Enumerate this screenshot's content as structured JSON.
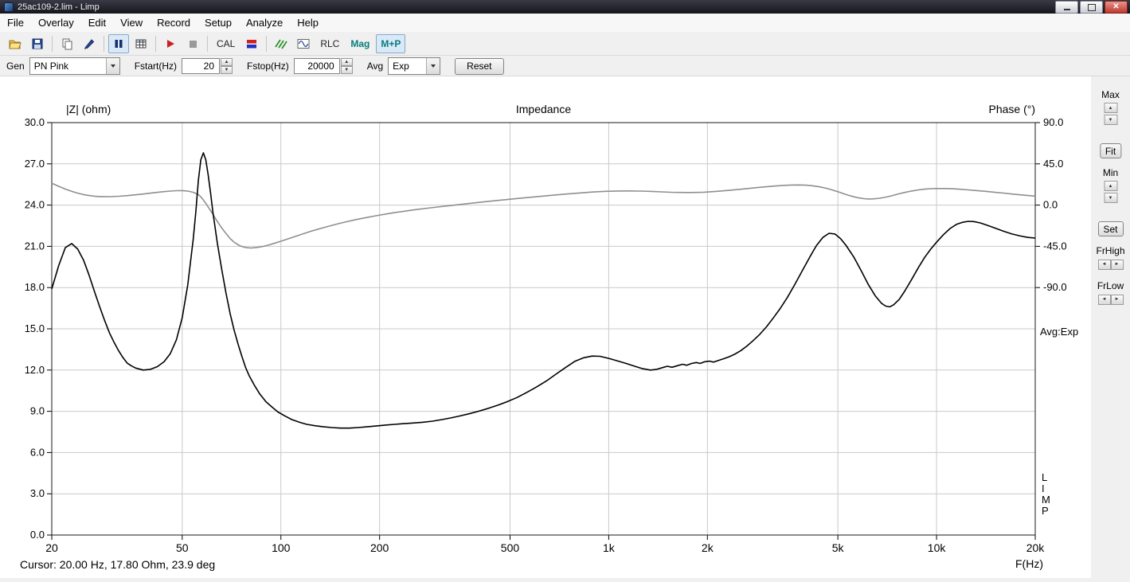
{
  "window": {
    "title": "25ac109-2.lim - Limp"
  },
  "menu": {
    "items": [
      "File",
      "Overlay",
      "Edit",
      "View",
      "Record",
      "Setup",
      "Analyze",
      "Help"
    ]
  },
  "toolbar": {
    "cal": "CAL",
    "rlc": "RLC",
    "mag": "Mag",
    "mp": "M+P"
  },
  "controls": {
    "gen_label": "Gen",
    "gen_value": "PN Pink",
    "fstart_label": "Fstart(Hz)",
    "fstart_value": "20",
    "fstop_label": "Fstop(Hz)",
    "fstop_value": "20000",
    "avg_label": "Avg",
    "avg_value": "Exp",
    "reset": "Reset"
  },
  "side_panel": {
    "max": "Max",
    "fit": "Fit",
    "min": "Min",
    "set": "Set",
    "frhigh": "FrHigh",
    "frlow": "FrLow"
  },
  "icons": {
    "up": "▲",
    "down": "▼",
    "left": "◄",
    "right": "►"
  },
  "status": {
    "cursor": "Cursor: 20.00 Hz, 17.80 Ohm, 23.9 deg"
  },
  "chart_data": {
    "type": "line",
    "title": "Impedance",
    "left_axis_label": "|Z| (ohm)",
    "right_axis_label": "Phase (°)",
    "xlabel": "F(Hz)",
    "x_scale": "log",
    "x_range": [
      20,
      20000
    ],
    "left_range": [
      0,
      30
    ],
    "grid": true,
    "x_ticks": [
      {
        "value": 20,
        "label": "20"
      },
      {
        "value": 50,
        "label": "50"
      },
      {
        "value": 100,
        "label": "100"
      },
      {
        "value": 200,
        "label": "200"
      },
      {
        "value": 500,
        "label": "500"
      },
      {
        "value": 1000,
        "label": "1k"
      },
      {
        "value": 2000,
        "label": "2k"
      },
      {
        "value": 5000,
        "label": "5k"
      },
      {
        "value": 10000,
        "label": "10k"
      },
      {
        "value": 20000,
        "label": "20k"
      }
    ],
    "left_ticks": [
      {
        "value": 0,
        "label": "0.0"
      },
      {
        "value": 3,
        "label": "3.0"
      },
      {
        "value": 6,
        "label": "6.0"
      },
      {
        "value": 9,
        "label": "9.0"
      },
      {
        "value": 12,
        "label": "12.0"
      },
      {
        "value": 15,
        "label": "15.0"
      },
      {
        "value": 18,
        "label": "18.0"
      },
      {
        "value": 21,
        "label": "21.0"
      },
      {
        "value": 24,
        "label": "24.0"
      },
      {
        "value": 27,
        "label": "27.0"
      },
      {
        "value": 30,
        "label": "30.0"
      }
    ],
    "right_ticks": [
      {
        "phase": 90,
        "label": "90.0"
      },
      {
        "phase": 45,
        "label": "45.0"
      },
      {
        "phase": 0,
        "label": "0.0"
      },
      {
        "phase": -45,
        "label": "-45.0"
      },
      {
        "phase": -90,
        "label": "-90.0"
      }
    ],
    "phase_axis": {
      "zero_z": 24,
      "deg_per_ohm": 15
    },
    "avg_annotation": "Avg:Exp",
    "watermark": "LIMP",
    "colors": {
      "impedance": "#000000",
      "phase": "#8f8f8f",
      "grid": "#c9c9c9",
      "border": "#1a1a1a"
    },
    "series": [
      {
        "name": "impedance_ohm",
        "axis": "left",
        "color_key": "impedance",
        "points": [
          [
            20,
            17.9
          ],
          [
            21,
            19.6
          ],
          [
            22,
            20.9
          ],
          [
            23,
            21.2
          ],
          [
            24,
            20.8
          ],
          [
            25,
            20
          ],
          [
            26,
            18.9
          ],
          [
            27,
            17.7
          ],
          [
            28,
            16.6
          ],
          [
            29,
            15.6
          ],
          [
            30,
            14.7
          ],
          [
            31,
            14
          ],
          [
            32,
            13.4
          ],
          [
            33,
            12.9
          ],
          [
            34,
            12.5
          ],
          [
            35,
            12.3
          ],
          [
            36,
            12.15
          ],
          [
            38,
            12
          ],
          [
            40,
            12.05
          ],
          [
            42,
            12.25
          ],
          [
            44,
            12.6
          ],
          [
            46,
            13.2
          ],
          [
            48,
            14.2
          ],
          [
            50,
            15.8
          ],
          [
            52,
            18.2
          ],
          [
            54,
            21.5
          ],
          [
            55,
            23.5
          ],
          [
            56,
            25.8
          ],
          [
            57,
            27.3
          ],
          [
            58,
            27.8
          ],
          [
            59,
            27.3
          ],
          [
            60,
            26.2
          ],
          [
            61,
            24.9
          ],
          [
            62,
            23.5
          ],
          [
            64,
            21.2
          ],
          [
            66,
            19.3
          ],
          [
            68,
            17.6
          ],
          [
            70,
            16.1
          ],
          [
            72,
            14.9
          ],
          [
            74,
            13.9
          ],
          [
            76,
            13
          ],
          [
            78,
            12.2
          ],
          [
            80,
            11.6
          ],
          [
            83,
            10.9
          ],
          [
            86,
            10.3
          ],
          [
            90,
            9.7
          ],
          [
            94,
            9.3
          ],
          [
            98,
            8.95
          ],
          [
            103,
            8.65
          ],
          [
            108,
            8.4
          ],
          [
            114,
            8.2
          ],
          [
            120,
            8.05
          ],
          [
            127,
            7.95
          ],
          [
            135,
            7.87
          ],
          [
            143,
            7.82
          ],
          [
            152,
            7.78
          ],
          [
            162,
            7.78
          ],
          [
            172,
            7.82
          ],
          [
            183,
            7.87
          ],
          [
            195,
            7.93
          ],
          [
            208,
            8
          ],
          [
            222,
            8.05
          ],
          [
            237,
            8.1
          ],
          [
            253,
            8.15
          ],
          [
            270,
            8.2
          ],
          [
            290,
            8.28
          ],
          [
            310,
            8.4
          ],
          [
            330,
            8.52
          ],
          [
            350,
            8.65
          ],
          [
            375,
            8.82
          ],
          [
            400,
            9
          ],
          [
            430,
            9.22
          ],
          [
            460,
            9.45
          ],
          [
            490,
            9.7
          ],
          [
            525,
            10
          ],
          [
            560,
            10.35
          ],
          [
            600,
            10.75
          ],
          [
            645,
            11.2
          ],
          [
            690,
            11.7
          ],
          [
            740,
            12.2
          ],
          [
            790,
            12.65
          ],
          [
            840,
            12.9
          ],
          [
            890,
            13.02
          ],
          [
            940,
            13
          ],
          [
            1000,
            12.85
          ],
          [
            1060,
            12.68
          ],
          [
            1130,
            12.48
          ],
          [
            1200,
            12.28
          ],
          [
            1270,
            12.1
          ],
          [
            1340,
            12
          ],
          [
            1400,
            12.05
          ],
          [
            1460,
            12.18
          ],
          [
            1510,
            12.28
          ],
          [
            1560,
            12.2
          ],
          [
            1620,
            12.32
          ],
          [
            1680,
            12.42
          ],
          [
            1730,
            12.35
          ],
          [
            1790,
            12.48
          ],
          [
            1850,
            12.55
          ],
          [
            1900,
            12.48
          ],
          [
            1960,
            12.6
          ],
          [
            2030,
            12.65
          ],
          [
            2090,
            12.58
          ],
          [
            2160,
            12.7
          ],
          [
            2240,
            12.82
          ],
          [
            2330,
            12.97
          ],
          [
            2430,
            13.17
          ],
          [
            2530,
            13.42
          ],
          [
            2640,
            13.75
          ],
          [
            2760,
            14.15
          ],
          [
            2890,
            14.6
          ],
          [
            3030,
            15.15
          ],
          [
            3180,
            15.8
          ],
          [
            3340,
            16.5
          ],
          [
            3510,
            17.3
          ],
          [
            3700,
            18.25
          ],
          [
            3900,
            19.25
          ],
          [
            4100,
            20.2
          ],
          [
            4300,
            21.05
          ],
          [
            4500,
            21.65
          ],
          [
            4700,
            21.95
          ],
          [
            4900,
            21.9
          ],
          [
            5100,
            21.55
          ],
          [
            5300,
            21.05
          ],
          [
            5600,
            20.2
          ],
          [
            5900,
            19.2
          ],
          [
            6200,
            18.2
          ],
          [
            6500,
            17.4
          ],
          [
            6800,
            16.85
          ],
          [
            7000,
            16.65
          ],
          [
            7200,
            16.6
          ],
          [
            7400,
            16.75
          ],
          [
            7700,
            17.15
          ],
          [
            8000,
            17.75
          ],
          [
            8400,
            18.6
          ],
          [
            8800,
            19.45
          ],
          [
            9200,
            20.2
          ],
          [
            9600,
            20.8
          ],
          [
            10000,
            21.3
          ],
          [
            10500,
            21.85
          ],
          [
            11000,
            22.3
          ],
          [
            11500,
            22.6
          ],
          [
            12000,
            22.75
          ],
          [
            12500,
            22.82
          ],
          [
            13000,
            22.8
          ],
          [
            13600,
            22.7
          ],
          [
            14200,
            22.55
          ],
          [
            15000,
            22.35
          ],
          [
            16000,
            22.1
          ],
          [
            17000,
            21.9
          ],
          [
            18000,
            21.75
          ],
          [
            19000,
            21.65
          ],
          [
            20000,
            21.6
          ]
        ]
      },
      {
        "name": "phase_deg",
        "axis": "phase",
        "color_key": "phase",
        "points": [
          [
            20,
            23.9
          ],
          [
            21,
            20.5
          ],
          [
            22,
            17.5
          ],
          [
            23,
            15
          ],
          [
            24,
            13
          ],
          [
            25,
            11.5
          ],
          [
            26,
            10.4
          ],
          [
            27,
            9.7
          ],
          [
            28,
            9.3
          ],
          [
            30,
            9.2
          ],
          [
            32,
            9.6
          ],
          [
            34,
            10.3
          ],
          [
            36,
            11.2
          ],
          [
            38,
            12.1
          ],
          [
            40,
            13
          ],
          [
            42,
            13.9
          ],
          [
            44,
            14.7
          ],
          [
            46,
            15.3
          ],
          [
            48,
            15.7
          ],
          [
            50,
            15.8
          ],
          [
            52,
            15.3
          ],
          [
            54,
            14
          ],
          [
            56,
            11.5
          ],
          [
            57,
            9
          ],
          [
            58,
            5.5
          ],
          [
            59,
            2
          ],
          [
            60,
            -2
          ],
          [
            62,
            -10
          ],
          [
            64,
            -18
          ],
          [
            66,
            -25
          ],
          [
            68,
            -31
          ],
          [
            70,
            -36.5
          ],
          [
            72,
            -40.5
          ],
          [
            75,
            -44.5
          ],
          [
            78,
            -46.3
          ],
          [
            81,
            -46.8
          ],
          [
            84,
            -46.3
          ],
          [
            88,
            -45.2
          ],
          [
            92,
            -43.4
          ],
          [
            96,
            -41.4
          ],
          [
            100,
            -39.4
          ],
          [
            106,
            -36.4
          ],
          [
            112,
            -33.5
          ],
          [
            118,
            -30.8
          ],
          [
            125,
            -28
          ],
          [
            132,
            -25.5
          ],
          [
            140,
            -23
          ],
          [
            150,
            -20.2
          ],
          [
            160,
            -17.8
          ],
          [
            170,
            -15.7
          ],
          [
            182,
            -13.6
          ],
          [
            195,
            -11.6
          ],
          [
            210,
            -9.6
          ],
          [
            225,
            -7.9
          ],
          [
            240,
            -6.5
          ],
          [
            260,
            -4.8
          ],
          [
            280,
            -3.4
          ],
          [
            300,
            -2.1
          ],
          [
            325,
            -0.7
          ],
          [
            350,
            0.6
          ],
          [
            380,
            2
          ],
          [
            410,
            3.3
          ],
          [
            450,
            4.8
          ],
          [
            490,
            6.1
          ],
          [
            530,
            7.3
          ],
          [
            580,
            8.6
          ],
          [
            630,
            9.8
          ],
          [
            690,
            11.1
          ],
          [
            750,
            12.2
          ],
          [
            820,
            13.3
          ],
          [
            900,
            14.3
          ],
          [
            980,
            15
          ],
          [
            1060,
            15.4
          ],
          [
            1150,
            15.5
          ],
          [
            1250,
            15.3
          ],
          [
            1350,
            14.9
          ],
          [
            1450,
            14.4
          ],
          [
            1550,
            14
          ],
          [
            1650,
            13.8
          ],
          [
            1750,
            13.7
          ],
          [
            1850,
            13.8
          ],
          [
            1950,
            14.1
          ],
          [
            2100,
            14.8
          ],
          [
            2250,
            15.6
          ],
          [
            2400,
            16.5
          ],
          [
            2600,
            17.7
          ],
          [
            2800,
            18.9
          ],
          [
            3000,
            19.9
          ],
          [
            3200,
            20.8
          ],
          [
            3400,
            21.5
          ],
          [
            3600,
            21.9
          ],
          [
            3800,
            22
          ],
          [
            4000,
            21.7
          ],
          [
            4200,
            21
          ],
          [
            4400,
            19.9
          ],
          [
            4600,
            18.4
          ],
          [
            4800,
            16.6
          ],
          [
            5000,
            14.6
          ],
          [
            5200,
            12.5
          ],
          [
            5400,
            10.6
          ],
          [
            5600,
            9
          ],
          [
            5800,
            7.8
          ],
          [
            6000,
            7
          ],
          [
            6200,
            6.7
          ],
          [
            6400,
            6.8
          ],
          [
            6700,
            7.5
          ],
          [
            7000,
            8.7
          ],
          [
            7300,
            10.2
          ],
          [
            7600,
            11.9
          ],
          [
            8000,
            13.8
          ],
          [
            8400,
            15.4
          ],
          [
            8800,
            16.6
          ],
          [
            9200,
            17.4
          ],
          [
            9600,
            17.9
          ],
          [
            10000,
            18.1
          ],
          [
            10600,
            18.1
          ],
          [
            11200,
            17.8
          ],
          [
            11800,
            17.3
          ],
          [
            12500,
            16.6
          ],
          [
            13200,
            15.9
          ],
          [
            14000,
            15.1
          ],
          [
            15000,
            14.1
          ],
          [
            16000,
            13.1
          ],
          [
            17000,
            12.1
          ],
          [
            18000,
            11.2
          ],
          [
            19000,
            10.4
          ],
          [
            20000,
            9.8
          ]
        ]
      }
    ]
  }
}
